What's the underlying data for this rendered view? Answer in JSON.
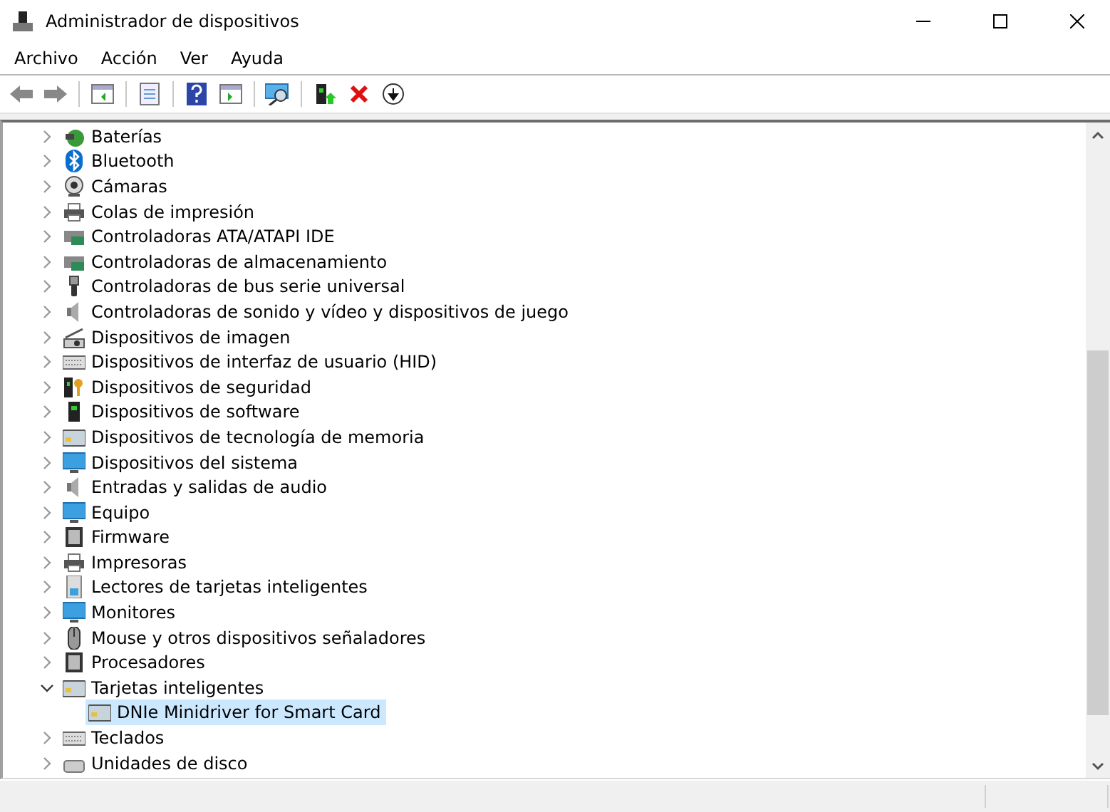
{
  "window": {
    "title": "Administrador de dispositivos"
  },
  "menu": [
    "Archivo",
    "Acción",
    "Ver",
    "Ayuda"
  ],
  "tree": [
    {
      "label": "Baterías",
      "expanded": false
    },
    {
      "label": "Bluetooth",
      "expanded": false
    },
    {
      "label": "Cámaras",
      "expanded": false
    },
    {
      "label": "Colas de impresión",
      "expanded": false
    },
    {
      "label": "Controladoras ATA/ATAPI IDE",
      "expanded": false
    },
    {
      "label": "Controladoras de almacenamiento",
      "expanded": false
    },
    {
      "label": "Controladoras de bus serie universal",
      "expanded": false
    },
    {
      "label": "Controladoras de sonido y vídeo y dispositivos de juego",
      "expanded": false
    },
    {
      "label": "Dispositivos de imagen",
      "expanded": false
    },
    {
      "label": "Dispositivos de interfaz de usuario (HID)",
      "expanded": false
    },
    {
      "label": "Dispositivos de seguridad",
      "expanded": false
    },
    {
      "label": "Dispositivos de software",
      "expanded": false
    },
    {
      "label": "Dispositivos de tecnología de memoria",
      "expanded": false
    },
    {
      "label": "Dispositivos del sistema",
      "expanded": false
    },
    {
      "label": "Entradas y salidas de audio",
      "expanded": false
    },
    {
      "label": "Equipo",
      "expanded": false
    },
    {
      "label": "Firmware",
      "expanded": false
    },
    {
      "label": "Impresoras",
      "expanded": false
    },
    {
      "label": "Lectores de tarjetas inteligentes",
      "expanded": false
    },
    {
      "label": "Monitores",
      "expanded": false
    },
    {
      "label": "Mouse y otros dispositivos señaladores",
      "expanded": false
    },
    {
      "label": "Procesadores",
      "expanded": false
    },
    {
      "label": "Tarjetas inteligentes",
      "expanded": true,
      "children": [
        {
          "label": "DNIe Minidriver for Smart Card",
          "selected": true
        }
      ]
    },
    {
      "label": "Teclados",
      "expanded": false
    },
    {
      "label": "Unidades de disco",
      "expanded": false
    }
  ]
}
